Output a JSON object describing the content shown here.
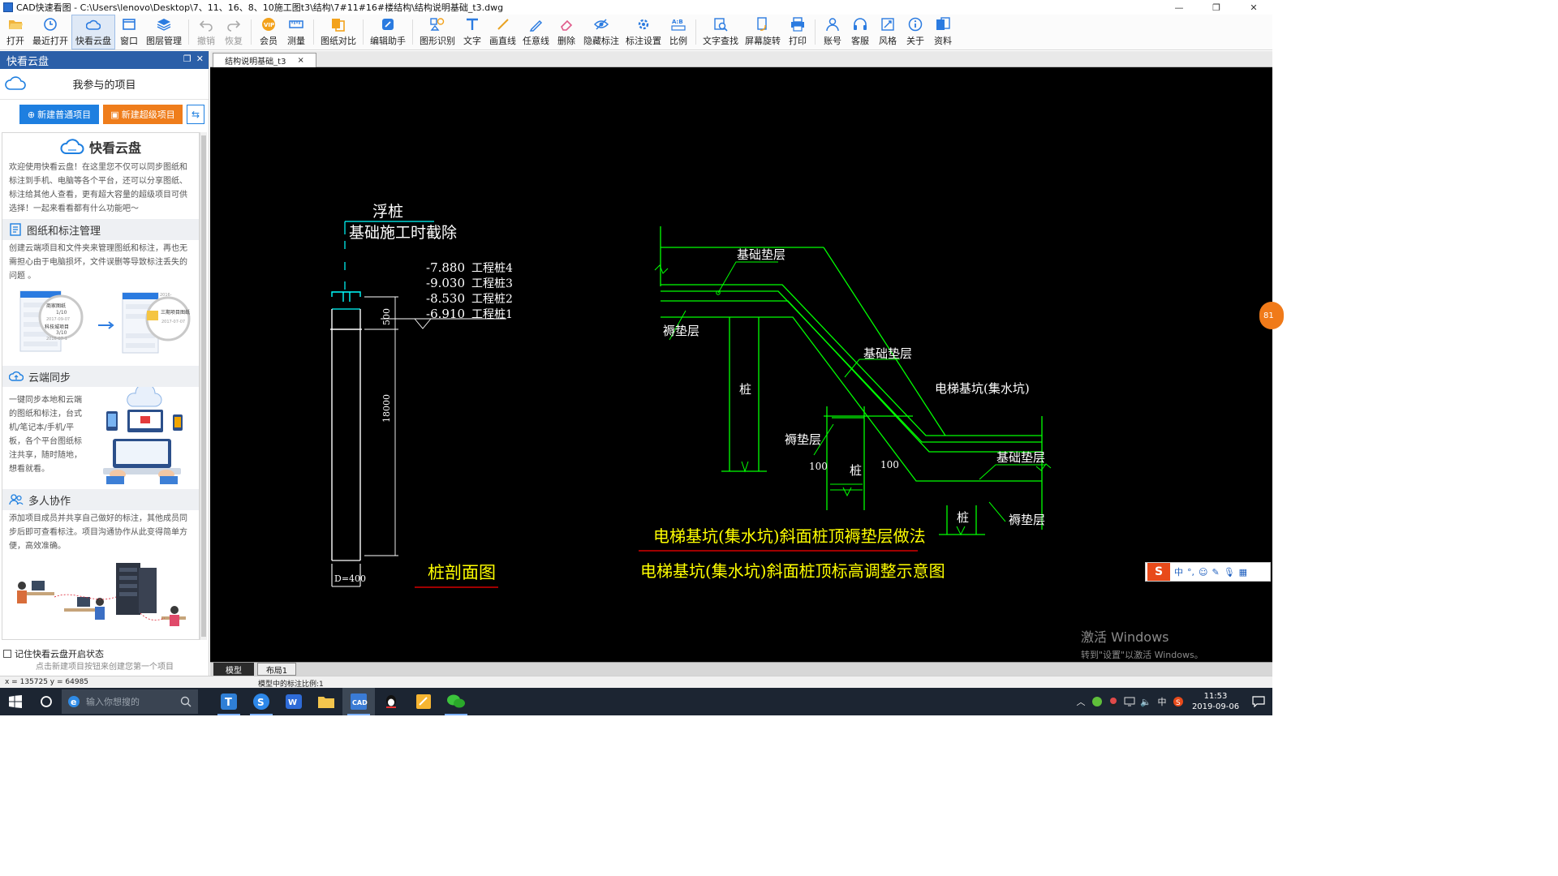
{
  "window": {
    "title": "CAD快速看图 - C:\\Users\\lenovo\\Desktop\\7、11、16、8、10施工图t3\\结构\\7#11#16#楼结构\\结构说明基础_t3.dwg",
    "min": "—",
    "max": "❐",
    "close": "✕"
  },
  "toolbar": {
    "items": [
      {
        "key": "open",
        "label": "打开",
        "icon": "folder-open-icon"
      },
      {
        "key": "recent",
        "label": "最近打开",
        "icon": "clock-icon"
      },
      {
        "key": "cloud",
        "label": "快看云盘",
        "icon": "cloud-icon",
        "active": true
      },
      {
        "key": "window",
        "label": "窗口",
        "icon": "window-icon"
      },
      {
        "key": "layers",
        "label": "图层管理",
        "icon": "layers-icon"
      },
      {
        "key": "undo",
        "label": "撤销",
        "icon": "undo-icon",
        "disabled": true
      },
      {
        "key": "redo",
        "label": "恢复",
        "icon": "redo-icon",
        "disabled": true
      },
      {
        "key": "vip",
        "label": "会员",
        "icon": "vip-icon"
      },
      {
        "key": "measure",
        "label": "测量",
        "icon": "ruler-icon"
      },
      {
        "key": "compare",
        "label": "图纸对比",
        "icon": "compare-icon"
      },
      {
        "key": "assistant",
        "label": "编辑助手",
        "icon": "edit-assistant-icon"
      },
      {
        "key": "recognize",
        "label": "图形识别",
        "icon": "shape-recognize-icon"
      },
      {
        "key": "text",
        "label": "文字",
        "icon": "text-icon"
      },
      {
        "key": "line",
        "label": "画直线",
        "icon": "line-icon"
      },
      {
        "key": "freeline",
        "label": "任意线",
        "icon": "pen-icon"
      },
      {
        "key": "delete",
        "label": "删除",
        "icon": "eraser-icon"
      },
      {
        "key": "hidemark",
        "label": "隐藏标注",
        "icon": "eye-hide-icon"
      },
      {
        "key": "markset",
        "label": "标注设置",
        "icon": "gear-icon"
      },
      {
        "key": "scale",
        "label": "比例",
        "icon": "scale-icon"
      },
      {
        "key": "findtext",
        "label": "文字查找",
        "icon": "search-text-icon"
      },
      {
        "key": "rotate",
        "label": "屏幕旋转",
        "icon": "rotate-screen-icon"
      },
      {
        "key": "print",
        "label": "打印",
        "icon": "printer-icon"
      },
      {
        "key": "account",
        "label": "账号",
        "icon": "user-icon"
      },
      {
        "key": "service",
        "label": "客服",
        "icon": "headset-icon"
      },
      {
        "key": "style",
        "label": "风格",
        "icon": "style-icon"
      },
      {
        "key": "about",
        "label": "关于",
        "icon": "info-icon"
      },
      {
        "key": "resources",
        "label": "资料",
        "icon": "resources-icon"
      }
    ]
  },
  "sidebar": {
    "header": "快看云盘",
    "project_title": "我参与的项目",
    "new_normal": "新建普通项目",
    "new_super": "新建超级项目",
    "panel": {
      "title": "快看云盘",
      "intro": "欢迎使用快看云盘！在这里您不仅可以同步图纸和标注到手机、电脑等各个平台，还可以分享图纸、标注给其他人查看，更有超大容量的超级项目可供选择！一起来看看都有什么功能吧～",
      "sec1_title": "图纸和标注管理",
      "sec1_desc": "创建云端项目和文件夹来管理图纸和标注，再也无需担心由于电脑损坏，文件误删等导致标注丢失的问题 。",
      "illus1": {
        "item_a": "商家图纸",
        "page_a": "1/10",
        "date_a": "2017-09-07",
        "item_b": "科技城项目",
        "page_b": "3/10",
        "date_b": "2016-07-1",
        "item_c": "三期项目图纸",
        "date_c": "2017-07-07",
        "date_d": "2016-"
      },
      "sec2_title": "云端同步",
      "sec2_desc": "一键同步本地和云端的图纸和标注，台式机/笔记本/手机/平板，各个平台图纸标注共享，随时随地，想看就看。",
      "sec3_title": "多人协作",
      "sec3_desc": "添加项目成员并共享自己做好的标注，其他成员同步后即可查看标注。项目沟通协作从此变得简单方便，高效准确。"
    },
    "remember_label": "记住快看云盘开启状态",
    "hint": "点击新建项目按钮来创建您第一个项目"
  },
  "doc_tab": {
    "name": "结构说明基础_t3",
    "close": "×"
  },
  "drawing": {
    "left": {
      "float_pile": "浮桩",
      "cut_note": "基础施工时截除",
      "elevations": [
        "-7.880",
        "-9.030",
        "-8.530",
        "-6.910"
      ],
      "piles": [
        "工程桩4",
        "工程桩3",
        "工程桩2",
        "工程桩1"
      ],
      "dim_500": "500",
      "dim_18000": "18000",
      "dia": "D=400",
      "caption": "桩剖面图"
    },
    "right": {
      "label_base_pad1": "基础垫层",
      "label_thin_pad1": "褥垫层",
      "label_base_pad2": "基础垫层",
      "label_pile1": "桩",
      "label_pit": "电梯基坑(集水坑)",
      "label_thin_pad2": "褥垫层",
      "label_100a": "100",
      "label_pile2": "桩",
      "label_100b": "100",
      "label_base_pad3": "基础垫层",
      "label_pile3": "桩",
      "label_thin_pad3": "褥垫层",
      "caption1": "电梯基坑(集水坑)斜面桩顶褥垫层做法",
      "caption2": "电梯基坑(集水坑)斜面桩顶标高调整示意图"
    }
  },
  "layout_tabs": {
    "model": "模型",
    "layout1": "布局1"
  },
  "status": {
    "coord": "x = 135725  y = 64985",
    "scale": "模型中的标注比例:1"
  },
  "watermark": {
    "line1": "激活 Windows",
    "line2": "转到\"设置\"以激活 Windows。"
  },
  "ime": {
    "logo": "S",
    "mode": "中"
  },
  "float_badge": "81",
  "taskbar": {
    "search_placeholder": "输入你想搜的",
    "ime_indicator": "中",
    "time": "11:53",
    "date": "2019-09-06"
  },
  "colors": {
    "cad_bg": "#000000",
    "cad_green": "#00ff00",
    "cad_white": "#ffffff",
    "cad_yellow": "#ffff00",
    "cad_cyan": "#00ffff",
    "cad_red": "#ff0000",
    "accent_blue": "#1e7fe0",
    "accent_orange": "#ef7d1b",
    "header_blue": "#2b5fa8"
  }
}
